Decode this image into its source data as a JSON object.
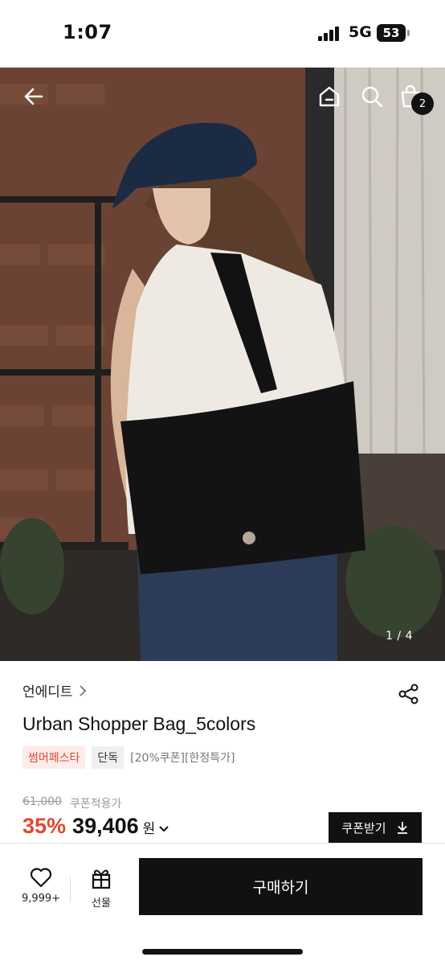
{
  "status_bar": {
    "time": "1:07",
    "network": "5G",
    "battery": "53"
  },
  "header": {
    "back_icon": "arrow-left-icon",
    "home_icon": "home-icon",
    "search_icon": "search-icon",
    "cart_icon": "shopping-bag-icon",
    "cart_count": "2"
  },
  "gallery": {
    "indicator": "1 / 4"
  },
  "product": {
    "brand": "언에디트",
    "title": "Urban Shopper Bag_5colors",
    "tags": {
      "promo": "썸머페스타",
      "exclusive": "단독",
      "info": "[20%쿠폰][한정특가]"
    },
    "original_price": "61,000",
    "coupon_note": "쿠폰적용가",
    "discount": "35%",
    "price": "39,406",
    "currency": "원",
    "coupon_button": "쿠폰받기"
  },
  "bottom_bar": {
    "like_count": "9,999+",
    "gift_label": "선물",
    "buy_label": "구매하기"
  },
  "colors": {
    "accent": "#e3472d",
    "primary": "#111111"
  }
}
